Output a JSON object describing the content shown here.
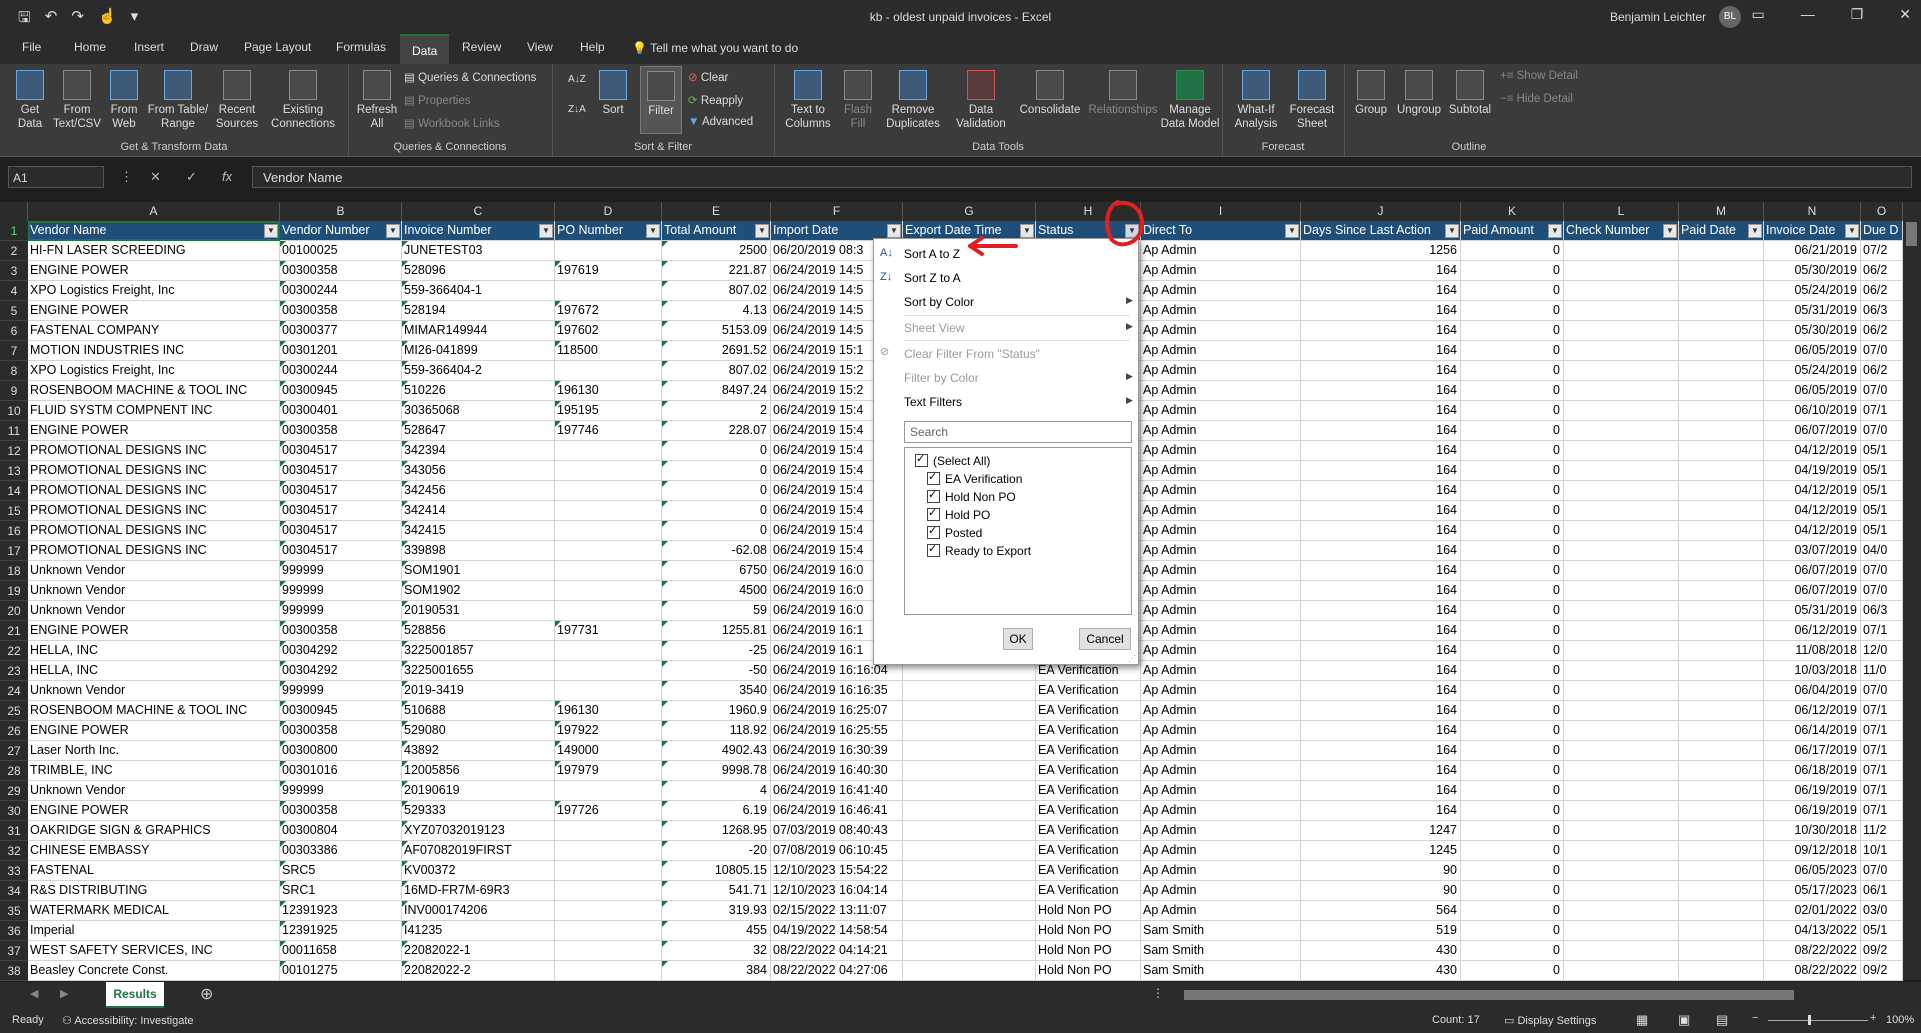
{
  "titlebar": {
    "title": "kb - oldest unpaid invoices  -  Excel",
    "user": "Benjamin Leichter",
    "initials": "BL"
  },
  "tabs": [
    "File",
    "Home",
    "Insert",
    "Draw",
    "Page Layout",
    "Formulas",
    "Data",
    "Review",
    "View",
    "Help"
  ],
  "active_tab": "Data",
  "tell_me": "Tell me what you want to do",
  "ribbon": {
    "get_transform": {
      "label": "Get & Transform Data",
      "get_data": "Get\nData",
      "from_text": "From\nText/CSV",
      "from_web": "From\nWeb",
      "from_table": "From Table/\nRange",
      "recent_sources": "Recent\nSources",
      "existing_connections": "Existing\nConnections"
    },
    "queries": {
      "label": "Queries & Connections",
      "refresh_all": "Refresh\nAll",
      "queries_connections": "Queries & Connections",
      "properties": "Properties",
      "workbook_links": "Workbook Links"
    },
    "sort_filter": {
      "label": "Sort & Filter",
      "sort": "Sort",
      "filter": "Filter",
      "clear": "Clear",
      "reapply": "Reapply",
      "advanced": "Advanced"
    },
    "data_tools": {
      "label": "Data Tools",
      "text_to_columns": "Text to\nColumns",
      "flash_fill": "Flash\nFill",
      "remove_duplicates": "Remove\nDuplicates",
      "data_validation": "Data\nValidation",
      "consolidate": "Consolidate",
      "relationships": "Relationships",
      "manage_data_model": "Manage\nData Model"
    },
    "forecast": {
      "label": "Forecast",
      "what_if": "What-If\nAnalysis",
      "forecast_sheet": "Forecast\nSheet"
    },
    "outline": {
      "label": "Outline",
      "group": "Group",
      "ungroup": "Ungroup",
      "subtotal": "Subtotal",
      "show_detail": "Show Detail",
      "hide_detail": "Hide Detail"
    }
  },
  "formula_bar": {
    "name_box": "A1",
    "formula": "Vendor Name"
  },
  "columns": [
    "A",
    "B",
    "C",
    "D",
    "E",
    "F",
    "G",
    "H",
    "I",
    "J",
    "K",
    "L",
    "M",
    "N",
    "O"
  ],
  "headers": [
    "Vendor Name",
    "Vendor Number",
    "Invoice Number",
    "PO Number",
    "Total Amount",
    "Import Date",
    "Export Date Time",
    "Status",
    "Direct To",
    "Days Since Last Action",
    "Paid Amount",
    "Check Number",
    "Paid Date",
    "Invoice Date",
    "Due D"
  ],
  "rows": [
    [
      "HI-FN LASER SCREEDING",
      "00100025",
      "JUNETEST03",
      "",
      "2500",
      "06/20/2019 08:3",
      "",
      "",
      "Ap Admin",
      "1256",
      "0",
      "",
      "",
      "06/21/2019",
      "07/2"
    ],
    [
      "ENGINE POWER",
      "00300358",
      "528096",
      "197619",
      "221.87",
      "06/24/2019 14:5",
      "",
      "",
      "Ap Admin",
      "164",
      "0",
      "",
      "",
      "05/30/2019",
      "06/2"
    ],
    [
      "XPO Logistics Freight, Inc",
      "00300244",
      "559-366404-1",
      "",
      "807.02",
      "06/24/2019 14:5",
      "",
      "",
      "Ap Admin",
      "164",
      "0",
      "",
      "",
      "05/24/2019",
      "06/2"
    ],
    [
      "ENGINE POWER",
      "00300358",
      "528194",
      "197672",
      "4.13",
      "06/24/2019 14:5",
      "",
      "",
      "Ap Admin",
      "164",
      "0",
      "",
      "",
      "05/31/2019",
      "06/3"
    ],
    [
      "FASTENAL COMPANY",
      "00300377",
      "MIMAR149944",
      "197602",
      "5153.09",
      "06/24/2019 14:5",
      "",
      "",
      "Ap Admin",
      "164",
      "0",
      "",
      "",
      "05/30/2019",
      "06/2"
    ],
    [
      "MOTION INDUSTRIES INC",
      "00301201",
      "MI26-041899",
      "118500",
      "2691.52",
      "06/24/2019 15:1",
      "",
      "",
      "Ap Admin",
      "164",
      "0",
      "",
      "",
      "06/05/2019",
      "07/0"
    ],
    [
      "XPO Logistics Freight, Inc",
      "00300244",
      "559-366404-2",
      "",
      "807.02",
      "06/24/2019 15:2",
      "",
      "",
      "Ap Admin",
      "164",
      "0",
      "",
      "",
      "05/24/2019",
      "06/2"
    ],
    [
      "ROSENBOOM MACHINE & TOOL INC",
      "00300945",
      "510226",
      "196130",
      "8497.24",
      "06/24/2019 15:2",
      "",
      "",
      "Ap Admin",
      "164",
      "0",
      "",
      "",
      "06/05/2019",
      "07/0"
    ],
    [
      "FLUID SYSTM COMPNENT INC",
      "00300401",
      "30365068",
      "195195",
      "2",
      "06/24/2019 15:4",
      "",
      "",
      "Ap Admin",
      "164",
      "0",
      "",
      "",
      "06/10/2019",
      "07/1"
    ],
    [
      "ENGINE POWER",
      "00300358",
      "528647",
      "197746",
      "228.07",
      "06/24/2019 15:4",
      "",
      "",
      "Ap Admin",
      "164",
      "0",
      "",
      "",
      "06/07/2019",
      "07/0"
    ],
    [
      "PROMOTIONAL DESIGNS INC",
      "00304517",
      "342394",
      "",
      "0",
      "06/24/2019 15:4",
      "",
      "",
      "Ap Admin",
      "164",
      "0",
      "",
      "",
      "04/12/2019",
      "05/1"
    ],
    [
      "PROMOTIONAL DESIGNS INC",
      "00304517",
      "343056",
      "",
      "0",
      "06/24/2019 15:4",
      "",
      "",
      "Ap Admin",
      "164",
      "0",
      "",
      "",
      "04/19/2019",
      "05/1"
    ],
    [
      "PROMOTIONAL DESIGNS INC",
      "00304517",
      "342456",
      "",
      "0",
      "06/24/2019 15:4",
      "",
      "",
      "Ap Admin",
      "164",
      "0",
      "",
      "",
      "04/12/2019",
      "05/1"
    ],
    [
      "PROMOTIONAL DESIGNS INC",
      "00304517",
      "342414",
      "",
      "0",
      "06/24/2019 15:4",
      "",
      "",
      "Ap Admin",
      "164",
      "0",
      "",
      "",
      "04/12/2019",
      "05/1"
    ],
    [
      "PROMOTIONAL DESIGNS INC",
      "00304517",
      "342415",
      "",
      "0",
      "06/24/2019 15:4",
      "",
      "",
      "Ap Admin",
      "164",
      "0",
      "",
      "",
      "04/12/2019",
      "05/1"
    ],
    [
      "PROMOTIONAL DESIGNS INC",
      "00304517",
      "339898",
      "",
      "-62.08",
      "06/24/2019 15:4",
      "",
      "",
      "Ap Admin",
      "164",
      "0",
      "",
      "",
      "03/07/2019",
      "04/0"
    ],
    [
      "Unknown Vendor",
      "999999",
      "SOM1901",
      "",
      "6750",
      "06/24/2019 16:0",
      "",
      "",
      "Ap Admin",
      "164",
      "0",
      "",
      "",
      "06/07/2019",
      "07/0"
    ],
    [
      "Unknown Vendor",
      "999999",
      "SOM1902",
      "",
      "4500",
      "06/24/2019 16:0",
      "",
      "",
      "Ap Admin",
      "164",
      "0",
      "",
      "",
      "06/07/2019",
      "07/0"
    ],
    [
      "Unknown Vendor",
      "999999",
      "20190531",
      "",
      "59",
      "06/24/2019 16:0",
      "",
      "",
      "Ap Admin",
      "164",
      "0",
      "",
      "",
      "05/31/2019",
      "06/3"
    ],
    [
      "ENGINE POWER",
      "00300358",
      "528856",
      "197731",
      "1255.81",
      "06/24/2019 16:1",
      "",
      "",
      "Ap Admin",
      "164",
      "0",
      "",
      "",
      "06/12/2019",
      "07/1"
    ],
    [
      "HELLA, INC",
      "00304292",
      "3225001857",
      "",
      "-25",
      "06/24/2019 16:1",
      "",
      "",
      "Ap Admin",
      "164",
      "0",
      "",
      "",
      "11/08/2018",
      "12/0"
    ],
    [
      "HELLA, INC",
      "00304292",
      "3225001655",
      "",
      "-50",
      "06/24/2019 16:16:04",
      "",
      "EA Verification",
      "Ap Admin",
      "164",
      "0",
      "",
      "",
      "10/03/2018",
      "11/0"
    ],
    [
      "Unknown Vendor",
      "999999",
      "2019-3419",
      "",
      "3540",
      "06/24/2019 16:16:35",
      "",
      "EA Verification",
      "Ap Admin",
      "164",
      "0",
      "",
      "",
      "06/04/2019",
      "07/0"
    ],
    [
      "ROSENBOOM MACHINE & TOOL INC",
      "00300945",
      "510688",
      "196130",
      "1960.9",
      "06/24/2019 16:25:07",
      "",
      "EA Verification",
      "Ap Admin",
      "164",
      "0",
      "",
      "",
      "06/12/2019",
      "07/1"
    ],
    [
      "ENGINE POWER",
      "00300358",
      "529080",
      "197922",
      "118.92",
      "06/24/2019 16:25:55",
      "",
      "EA Verification",
      "Ap Admin",
      "164",
      "0",
      "",
      "",
      "06/14/2019",
      "07/1"
    ],
    [
      "Laser North Inc.",
      "00300800",
      "43892",
      "149000",
      "4902.43",
      "06/24/2019 16:30:39",
      "",
      "EA Verification",
      "Ap Admin",
      "164",
      "0",
      "",
      "",
      "06/17/2019",
      "07/1"
    ],
    [
      "TRIMBLE, INC",
      "00301016",
      "12005856",
      "197979",
      "9998.78",
      "06/24/2019 16:40:30",
      "",
      "EA Verification",
      "Ap Admin",
      "164",
      "0",
      "",
      "",
      "06/18/2019",
      "07/1"
    ],
    [
      "Unknown Vendor",
      "999999",
      "20190619",
      "",
      "4",
      "06/24/2019 16:41:40",
      "",
      "EA Verification",
      "Ap Admin",
      "164",
      "0",
      "",
      "",
      "06/19/2019",
      "07/1"
    ],
    [
      "ENGINE POWER",
      "00300358",
      "529333",
      "197726",
      "6.19",
      "06/24/2019 16:46:41",
      "",
      "EA Verification",
      "Ap Admin",
      "164",
      "0",
      "",
      "",
      "06/19/2019",
      "07/1"
    ],
    [
      "OAKRIDGE SIGN & GRAPHICS",
      "00300804",
      "XYZ07032019123",
      "",
      "1268.95",
      "07/03/2019 08:40:43",
      "",
      "EA Verification",
      "Ap Admin",
      "1247",
      "0",
      "",
      "",
      "10/30/2018",
      "11/2"
    ],
    [
      "CHINESE EMBASSY",
      "00303386",
      "AF07082019FIRST",
      "",
      "-20",
      "07/08/2019 06:10:45",
      "",
      "EA Verification",
      "Ap Admin",
      "1245",
      "0",
      "",
      "",
      "09/12/2018",
      "10/1"
    ],
    [
      "FASTENAL",
      "SRC5",
      "KV00372",
      "",
      "10805.15",
      "12/10/2023 15:54:22",
      "",
      "EA Verification",
      "Ap Admin",
      "90",
      "0",
      "",
      "",
      "06/05/2023",
      "07/0"
    ],
    [
      "R&S DISTRIBUTING",
      "SRC1",
      "16MD-FR7M-69R3",
      "",
      "541.71",
      "12/10/2023 16:04:14",
      "",
      "EA Verification",
      "Ap Admin",
      "90",
      "0",
      "",
      "",
      "05/17/2023",
      "06/1"
    ],
    [
      "WATERMARK MEDICAL",
      "12391923",
      "INV000174206",
      "",
      "319.93",
      "02/15/2022 13:11:07",
      "",
      "Hold Non PO",
      "Ap Admin",
      "564",
      "0",
      "",
      "",
      "02/01/2022",
      "03/0"
    ],
    [
      "Imperial",
      "12391925",
      "I41235",
      "",
      "455",
      "04/19/2022 14:58:54",
      "",
      "Hold Non PO",
      "Sam Smith",
      "519",
      "0",
      "",
      "",
      "04/13/2022",
      "05/1"
    ],
    [
      "WEST SAFETY SERVICES, INC",
      "00011658",
      "22082022-1",
      "",
      "32",
      "08/22/2022 04:14:21",
      "",
      "Hold Non PO",
      "Sam Smith",
      "430",
      "0",
      "",
      "",
      "08/22/2022",
      "09/2"
    ],
    [
      "Beasley Concrete Const.",
      "00101275",
      "22082022-2",
      "",
      "384",
      "08/22/2022 04:27:06",
      "",
      "Hold Non PO",
      "Sam Smith",
      "430",
      "0",
      "",
      "",
      "08/22/2022",
      "09/2"
    ]
  ],
  "filter_menu": {
    "sort_az": "Sort A to Z",
    "sort_za": "Sort Z to A",
    "sort_by_color": "Sort by Color",
    "sheet_view": "Sheet View",
    "clear_filter": "Clear Filter From \"Status\"",
    "filter_by_color": "Filter by Color",
    "text_filters": "Text Filters",
    "search_placeholder": "Search",
    "options": [
      "(Select All)",
      "EA Verification",
      "Hold Non PO",
      "Hold PO",
      "Posted",
      "Ready to Export"
    ],
    "ok": "OK",
    "cancel": "Cancel"
  },
  "sheet_tab": "Results",
  "status": {
    "ready": "Ready",
    "accessibility": "Accessibility: Investigate",
    "count": "Count: 17",
    "display_settings": "Display Settings",
    "zoom": "100%"
  },
  "colors": {
    "header_fill": "#1f4e78",
    "excel_green": "#217346",
    "annotation_red": "#e02020"
  }
}
